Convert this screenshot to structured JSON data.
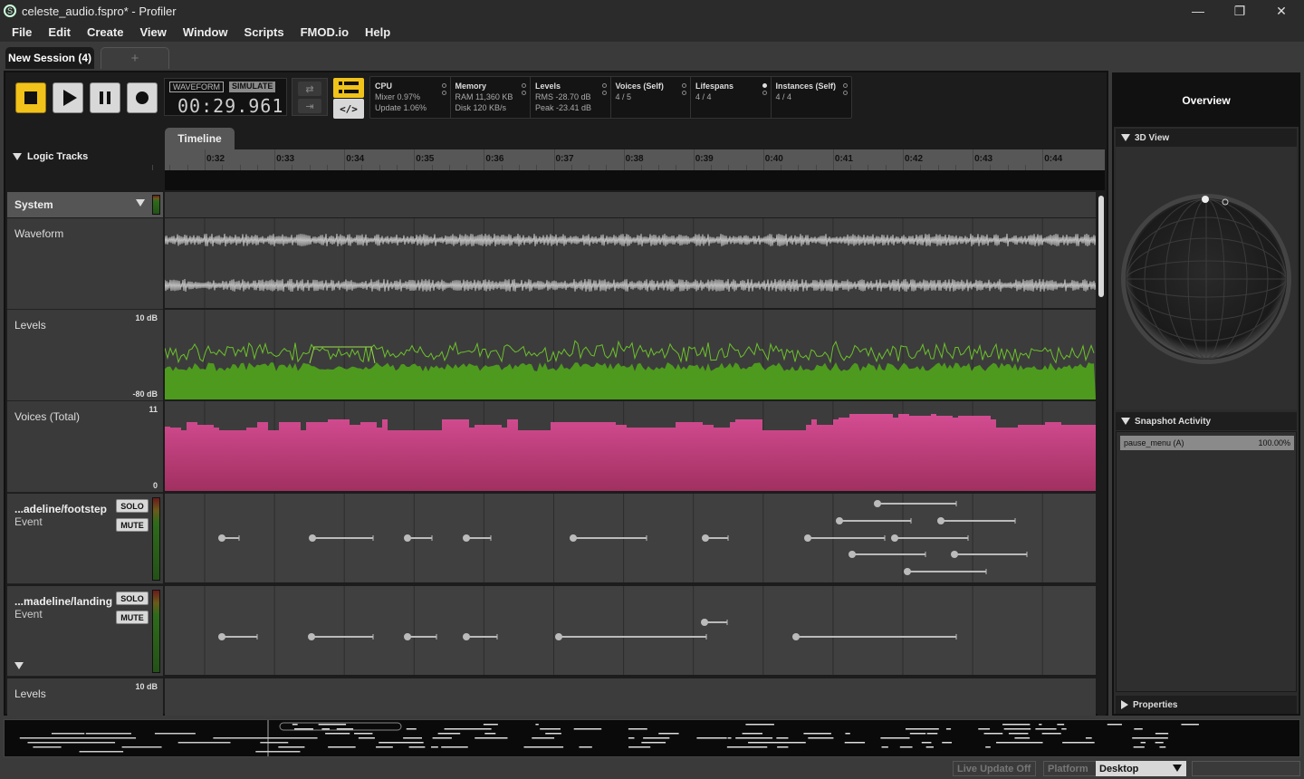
{
  "window": {
    "title": "celeste_audio.fspro* - Profiler",
    "icon": "fmod-logo-icon",
    "minimize": "—",
    "maximize": "❐",
    "close": "✕"
  },
  "menu": [
    "File",
    "Edit",
    "Create",
    "View",
    "Window",
    "Scripts",
    "FMOD.io",
    "Help"
  ],
  "session_tabs": {
    "active": "New Session (4)",
    "add": "+"
  },
  "transport": {
    "mode_waveform": "WAVEFORM",
    "mode_simulate": "SIMULATE",
    "time": "00:29.961",
    "loop_icon": "⇄",
    "follow_icon": "⇥",
    "list_icon": "list-view-icon",
    "code_label": "</>"
  },
  "stats": [
    {
      "label": "CPU",
      "lines": [
        "Mixer 0.97%",
        "Update 1.06%"
      ],
      "dots": [
        false,
        false
      ]
    },
    {
      "label": "Memory",
      "lines": [
        "RAM 11,360 KB",
        "Disk 120 KB/s"
      ],
      "dots": [
        false,
        false
      ]
    },
    {
      "label": "Levels",
      "lines": [
        "RMS -28.70 dB",
        "Peak -23.41 dB"
      ],
      "dots": [
        false,
        false
      ]
    },
    {
      "label": "Voices (Self)",
      "lines": [
        "4 / 5",
        ""
      ],
      "dots": [
        false,
        false
      ]
    },
    {
      "label": "Lifespans",
      "lines": [
        "4 / 4",
        ""
      ],
      "dots": [
        true,
        false
      ]
    },
    {
      "label": "Instances (Self)",
      "lines": [
        "4 / 4",
        ""
      ],
      "dots": [
        false,
        false
      ]
    }
  ],
  "timeline": {
    "tab": "Timeline",
    "logic_tracks": "Logic Tracks",
    "ruler_labels": [
      "0:32",
      "0:33",
      "0:34",
      "0:35",
      "0:36",
      "0:37",
      "0:38",
      "0:39",
      "0:40",
      "0:41",
      "0:42",
      "0:43",
      "0:44"
    ]
  },
  "tracks": {
    "system": "System",
    "waveform": "Waveform",
    "levels": {
      "name": "Levels",
      "top": "10 dB",
      "bottom": "-80 dB"
    },
    "voices": {
      "name": "Voices (Total)",
      "top": "11",
      "bottom": "0"
    },
    "footstep": {
      "name": "...adeline/footstep",
      "type": "Event",
      "solo": "SOLO",
      "mute": "MUTE"
    },
    "landing": {
      "name": "...madeline/landing",
      "type": "Event",
      "solo": "SOLO",
      "mute": "MUTE"
    },
    "levels2": {
      "name": "Levels",
      "top": "10 dB"
    }
  },
  "status": {
    "live_update": "Live Update Off",
    "platform_label": "Platform",
    "platform_value": "Desktop"
  },
  "right": {
    "overview": "Overview",
    "view3d": "3D View",
    "snapshot": "Snapshot Activity",
    "snapshot_row": {
      "name": "pause_menu (A)",
      "value": "100.00%"
    },
    "properties": "Properties"
  },
  "colors": {
    "accent": "#f0c21a",
    "levels_green": "#4e9a1e",
    "voices_pink": "#c0437e"
  }
}
